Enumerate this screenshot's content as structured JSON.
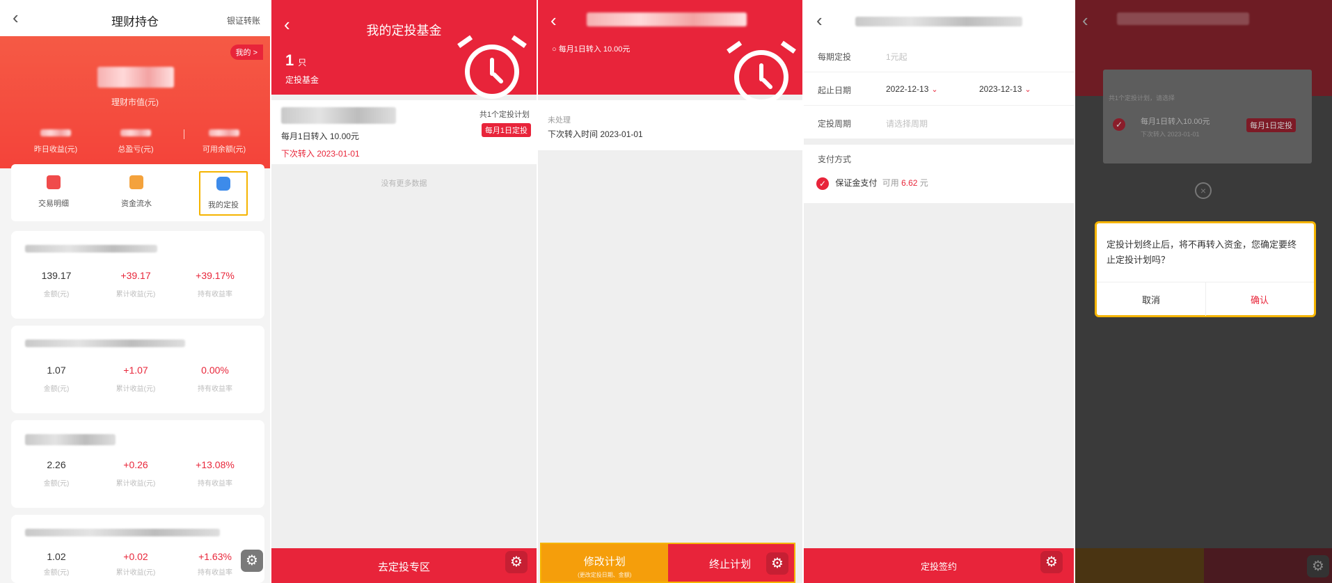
{
  "screen1": {
    "title": "理财持仓",
    "nav_right": "银证转账",
    "my_pill": "我的 >",
    "hero_label": "理财市值(元)",
    "stats": [
      "昨日收益(元)",
      "总盈亏(元)",
      "可用余额(元)"
    ],
    "quick": [
      "交易明细",
      "资金流水",
      "我的定投"
    ],
    "col_labels": [
      "金额(元)",
      "累计收益(元)",
      "持有收益率"
    ],
    "holdings": [
      {
        "amount": "139.17",
        "profit": "+39.17",
        "rate": "+39.17%"
      },
      {
        "amount": "1.07",
        "profit": "+1.07",
        "rate": "0.00%"
      },
      {
        "amount": "2.26",
        "profit": "+0.26",
        "rate": "+13.08%"
      },
      {
        "amount": "1.02",
        "profit": "+0.02",
        "rate": "+1.63%"
      }
    ]
  },
  "screen2": {
    "title": "我的定投基金",
    "count": "1",
    "count_unit": "只",
    "count_label": "定投基金",
    "plan_count": "共1个定投计划",
    "badge": "每月1日定投",
    "amount_text": "每月1日转入 10.00元",
    "next_text": "下次转入 2023-01-01",
    "no_more": "没有更多数据",
    "bottom_btn": "去定投专区"
  },
  "screen3": {
    "sub_text": "每月1日转入 10.00元",
    "status": "未处理",
    "next_time": "下次转入时间 2023-01-01",
    "modify_btn": "修改计划",
    "modify_sub": "(更改定投日期、金额)",
    "stop_btn": "终止计划"
  },
  "screen4": {
    "rows": [
      {
        "key": "每期定投",
        "value": "1元起"
      },
      {
        "key": "起止日期",
        "start": "2022-12-13",
        "end": "2023-12-13"
      },
      {
        "key": "定投周期",
        "value": "请选择周期"
      }
    ],
    "pay_title": "支付方式",
    "pay_method": "保证金支付",
    "pay_available": "可用",
    "pay_amount": "6.62",
    "pay_unit": "元",
    "bottom_btn": "定投签约"
  },
  "screen5": {
    "card_hint": "共1个定投计划，请选择",
    "card_item": "每月1日转入10.00元",
    "card_next": "下次转入 2023-01-01",
    "card_badge": "每月1日定投",
    "dialog_msg": "定投计划终止后，将不再转入资金，您确定要终止定投计划吗？",
    "cancel": "取消",
    "confirm": "确认"
  },
  "colors": {
    "brand_red": "#e8243a",
    "highlight": "#f5b400",
    "orange": "#f59e0b"
  },
  "icons": [
    "back-icon",
    "alarm-clock-icon",
    "gear-icon",
    "chevron-down-icon",
    "check-icon",
    "close-icon"
  ]
}
